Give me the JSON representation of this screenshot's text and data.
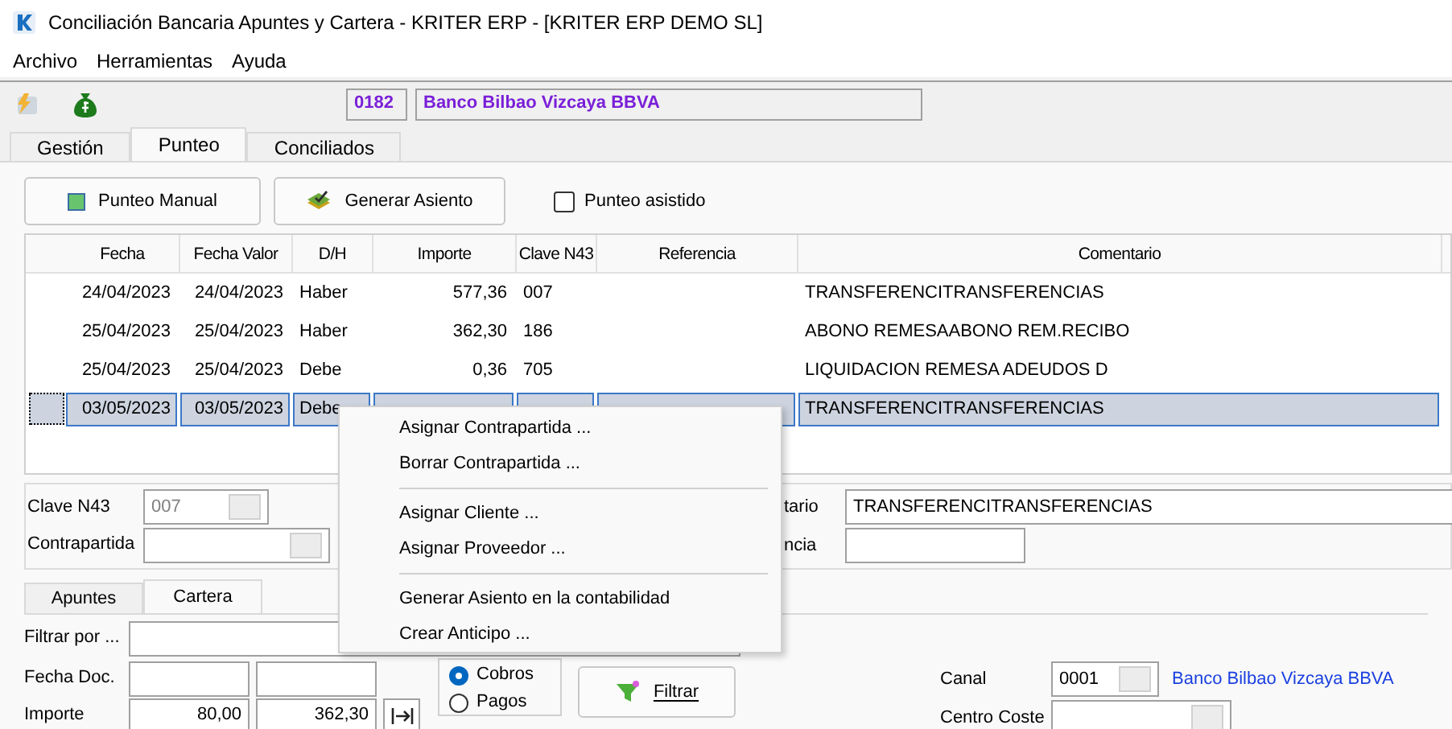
{
  "window": {
    "title": "Conciliación Bancaria Apuntes y Cartera - KRITER ERP - [KRITER ERP DEMO SL]"
  },
  "menu_bar": [
    "Archivo",
    "Herramientas",
    "Ayuda"
  ],
  "bank": {
    "code": "0182",
    "name": "Banco Bilbao Vizcaya BBVA"
  },
  "tabs": [
    {
      "label": "Gestión",
      "selected": false
    },
    {
      "label": "Punteo",
      "selected": true
    },
    {
      "label": "Conciliados",
      "selected": false
    }
  ],
  "actions": {
    "manual": "Punteo Manual",
    "generate": "Generar Asiento",
    "assisted": {
      "label": "Punteo asistido",
      "checked": false
    }
  },
  "table": {
    "columns": [
      "Fecha",
      "Fecha Valor",
      "D/H",
      "Importe",
      "Clave N43",
      "Referencia",
      "Comentario"
    ],
    "rows": [
      {
        "selected": false,
        "cells": [
          "24/04/2023",
          "24/04/2023",
          "Haber",
          "577,36",
          "007",
          "",
          "TRANSFERENCITRANSFERENCIAS"
        ]
      },
      {
        "selected": false,
        "cells": [
          "25/04/2023",
          "25/04/2023",
          "Haber",
          "362,30",
          "186",
          "",
          "ABONO REMESAABONO REM.RECIBO"
        ]
      },
      {
        "selected": false,
        "cells": [
          "25/04/2023",
          "25/04/2023",
          "Debe",
          "0,36",
          "705",
          "",
          "LIQUIDACION REMESA ADEUDOS D"
        ]
      },
      {
        "selected": true,
        "cells": [
          "03/05/2023",
          "03/05/2023",
          "Debe",
          "",
          "",
          "",
          "TRANSFERENCITRANSFERENCIAS"
        ]
      }
    ]
  },
  "detail": {
    "clave_label": "Clave N43",
    "clave_value": "007",
    "contrapartida_label": "Contrapartida",
    "comment_label": "tario",
    "comment_value": "TRANSFERENCITRANSFERENCIAS",
    "reference_label": "ncia"
  },
  "sub_tabs": [
    {
      "label": "Apuntes",
      "selected": false
    },
    {
      "label": "Cartera",
      "selected": true
    }
  ],
  "filter": {
    "filter_label": "Filtrar por ...",
    "date_label": "Fecha Doc.",
    "amount_label": "Importe",
    "amount_from": "80,00",
    "amount_to": "362,30",
    "radios": [
      {
        "label": "Cobros",
        "selected": true
      },
      {
        "label": "Pagos",
        "selected": false
      }
    ],
    "filter_button": "Filtrar",
    "channel_label": "Canal",
    "channel_code": "0001",
    "channel_name": "Banco Bilbao Vizcaya BBVA",
    "cost_center_label": "Centro Coste"
  },
  "context_menu": [
    {
      "kind": "item",
      "label": "Asignar Contrapartida ..."
    },
    {
      "kind": "item",
      "label": "Borrar Contrapartida ..."
    },
    {
      "kind": "separator"
    },
    {
      "kind": "item",
      "label": "Asignar Cliente ..."
    },
    {
      "kind": "item",
      "label": "Asignar Proveedor ..."
    },
    {
      "kind": "separator"
    },
    {
      "kind": "item",
      "label": "Generar Asiento en la contabilidad"
    },
    {
      "kind": "item",
      "label": "Crear Anticipo ..."
    }
  ]
}
